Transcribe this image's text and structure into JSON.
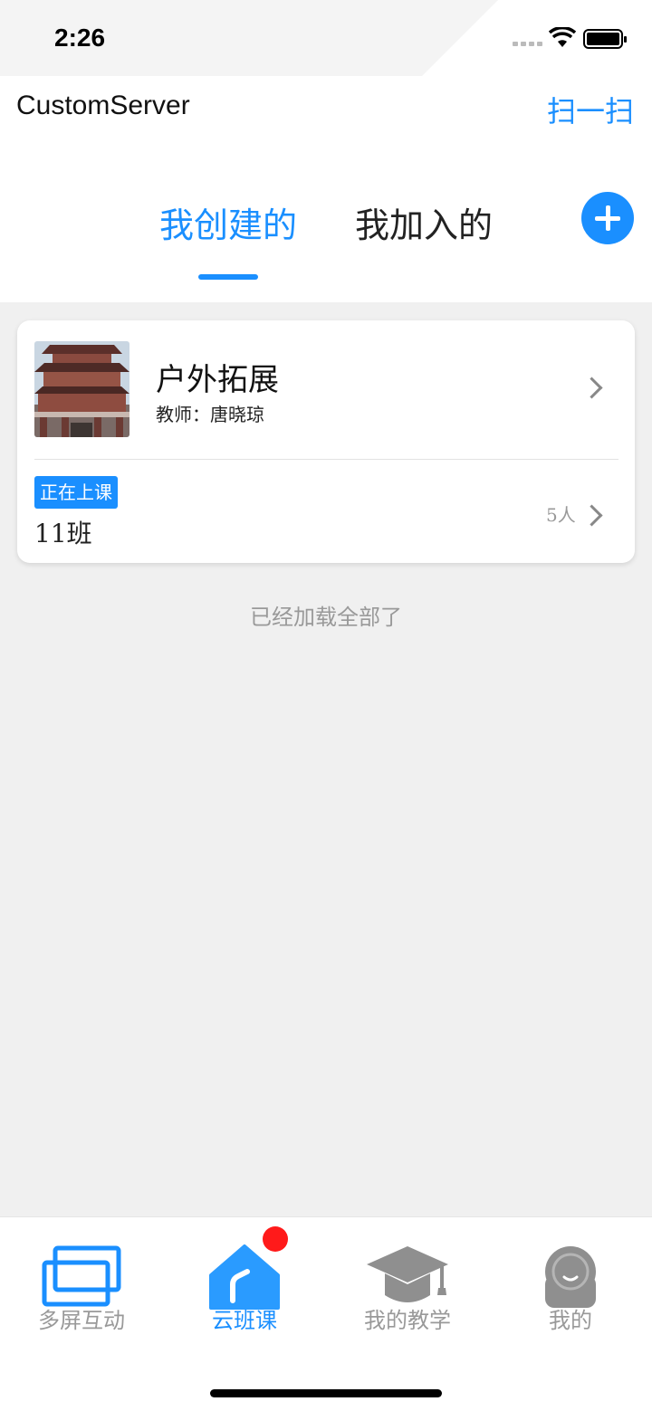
{
  "status_bar": {
    "time": "2:26"
  },
  "header": {
    "app_title": "CustomServer",
    "scan_label": "扫一扫",
    "tabs": [
      {
        "label": "我创建的",
        "active": true
      },
      {
        "label": "我加入的",
        "active": false
      }
    ],
    "add_icon": "plus-circle-icon"
  },
  "course_card": {
    "title": "户外拓展",
    "teacher_label": "教师：",
    "teacher_name": "唐晓琼",
    "status": "正在上课",
    "class_name": "11班",
    "member_count": "5人"
  },
  "list_footer": "已经加载全部了",
  "bottom_nav": {
    "items": [
      {
        "label": "多屏互动",
        "icon": "multi-screen-icon",
        "active": false
      },
      {
        "label": "云班课",
        "icon": "home-icon",
        "active": true
      },
      {
        "label": "我的教学",
        "icon": "graduation-cap-icon",
        "active": false
      },
      {
        "label": "我的",
        "icon": "profile-icon",
        "active": false
      }
    ]
  },
  "colors": {
    "accent": "#1a8fff",
    "badge": "#ff1a1a",
    "background": "#f0f0f0"
  }
}
